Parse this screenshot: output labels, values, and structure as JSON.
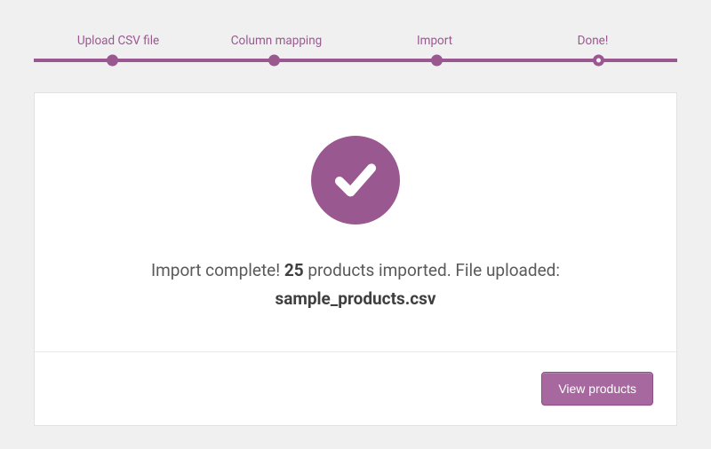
{
  "colors": {
    "accent": "#9a5891",
    "button": "#a7689f"
  },
  "stepper": {
    "steps": [
      {
        "label": "Upload CSV file",
        "state": "complete"
      },
      {
        "label": "Column mapping",
        "state": "complete"
      },
      {
        "label": "Import",
        "state": "complete"
      },
      {
        "label": "Done!",
        "state": "current"
      }
    ]
  },
  "result": {
    "prefix": "Import complete! ",
    "count": "25",
    "suffix": " products imported. File uploaded:",
    "filename": "sample_products.csv"
  },
  "actions": {
    "view_products": "View products"
  }
}
